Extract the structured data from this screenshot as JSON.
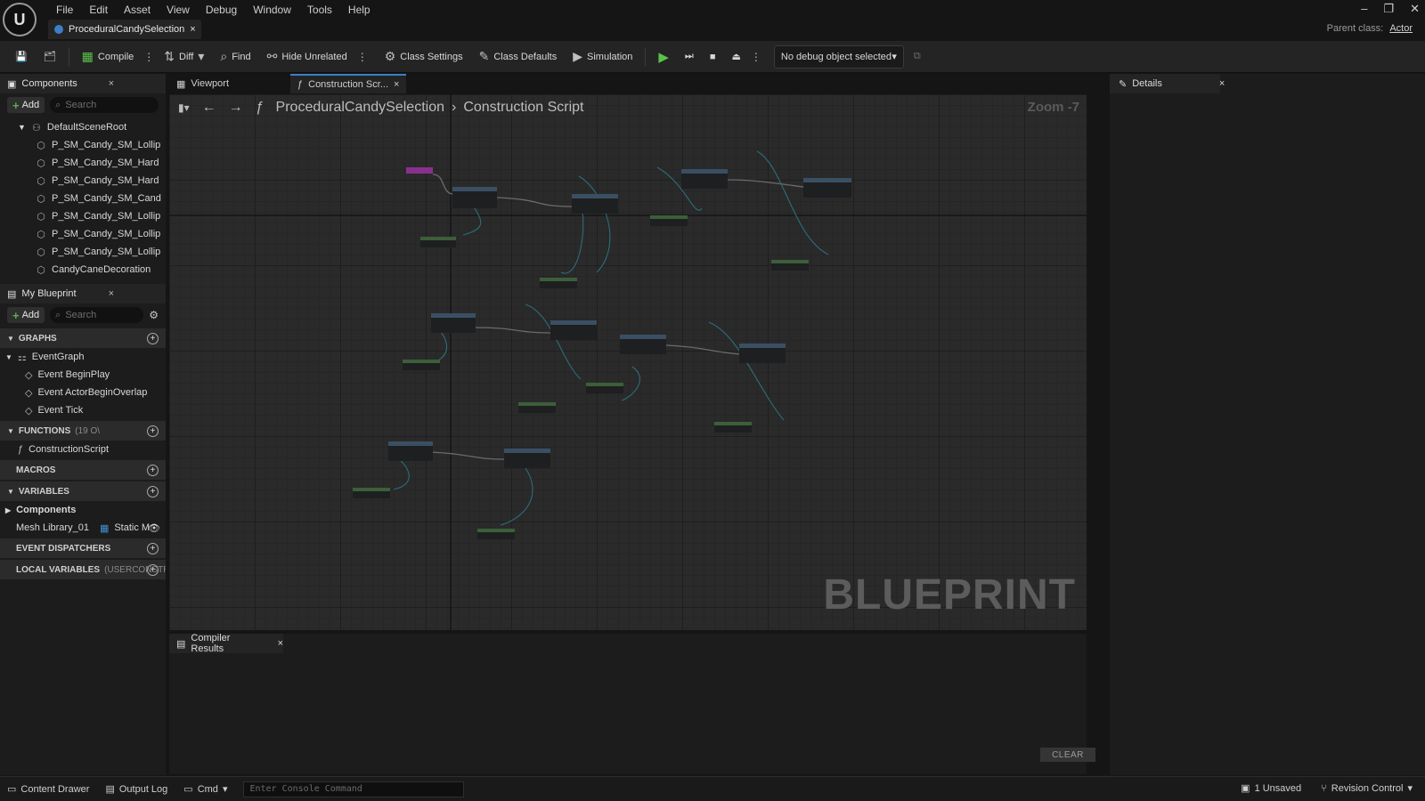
{
  "menu": [
    "File",
    "Edit",
    "Asset",
    "View",
    "Debug",
    "Window",
    "Tools",
    "Help"
  ],
  "document_tab": "ProceduralCandySelection",
  "parent_class": {
    "label": "Parent class:",
    "value": "Actor"
  },
  "toolbar": {
    "compile": "Compile",
    "diff": "Diff",
    "find": "Find",
    "hide_unrelated": "Hide Unrelated",
    "class_settings": "Class Settings",
    "class_defaults": "Class Defaults",
    "simulation": "Simulation",
    "debug_object": "No debug object selected"
  },
  "components": {
    "title": "Components",
    "add": "Add",
    "search_placeholder": "Search",
    "root": "DefaultSceneRoot",
    "items": [
      "P_SM_Candy_SM_Lollip",
      "P_SM_Candy_SM_Hard",
      "P_SM_Candy_SM_Hard",
      "P_SM_Candy_SM_Cand",
      "P_SM_Candy_SM_Lollip",
      "P_SM_Candy_SM_Lollip",
      "P_SM_Candy_SM_Lollip",
      "CandyCaneDecoration"
    ]
  },
  "my_blueprint": {
    "title": "My Blueprint",
    "add": "Add",
    "search_placeholder": "Search",
    "graphs_label": "GRAPHS",
    "event_graph": "EventGraph",
    "events": [
      "Event BeginPlay",
      "Event ActorBeginOverlap",
      "Event Tick"
    ],
    "functions_label": "FUNCTIONS",
    "functions_count": "(19 O\\",
    "construction_script": "ConstructionScript",
    "macros_label": "MACROS",
    "variables_label": "VARIABLES",
    "components_cat": "Components",
    "var_name": "Mesh Library_01",
    "var_type": "Static M",
    "dispatchers_label": "EVENT DISPATCHERS",
    "local_vars_label": "LOCAL VARIABLES",
    "local_vars_sub": "(USERCONSTRU"
  },
  "graph_tabs": {
    "viewport": "Viewport",
    "construction": "Construction Scr..."
  },
  "graph": {
    "breadcrumb_root": "ProceduralCandySelection",
    "breadcrumb_leaf": "Construction Script",
    "zoom": "Zoom -7",
    "watermark": "BLUEPRINT"
  },
  "compiler": {
    "title": "Compiler Results",
    "clear": "CLEAR"
  },
  "details": {
    "title": "Details"
  },
  "statusbar": {
    "content_drawer": "Content Drawer",
    "output_log": "Output Log",
    "cmd": "Cmd",
    "console_placeholder": "Enter Console Command",
    "unsaved": "1 Unsaved",
    "revision": "Revision Control"
  },
  "colors": {
    "accent": "#3d7fc6",
    "play": "#59c24b",
    "node_body": "#1d1f21",
    "node_header_func": "#3a4f63",
    "node_header_pure": "#3c5f3a",
    "node_header_event": "#8b2f8f",
    "wire": "#3a7d8f"
  }
}
